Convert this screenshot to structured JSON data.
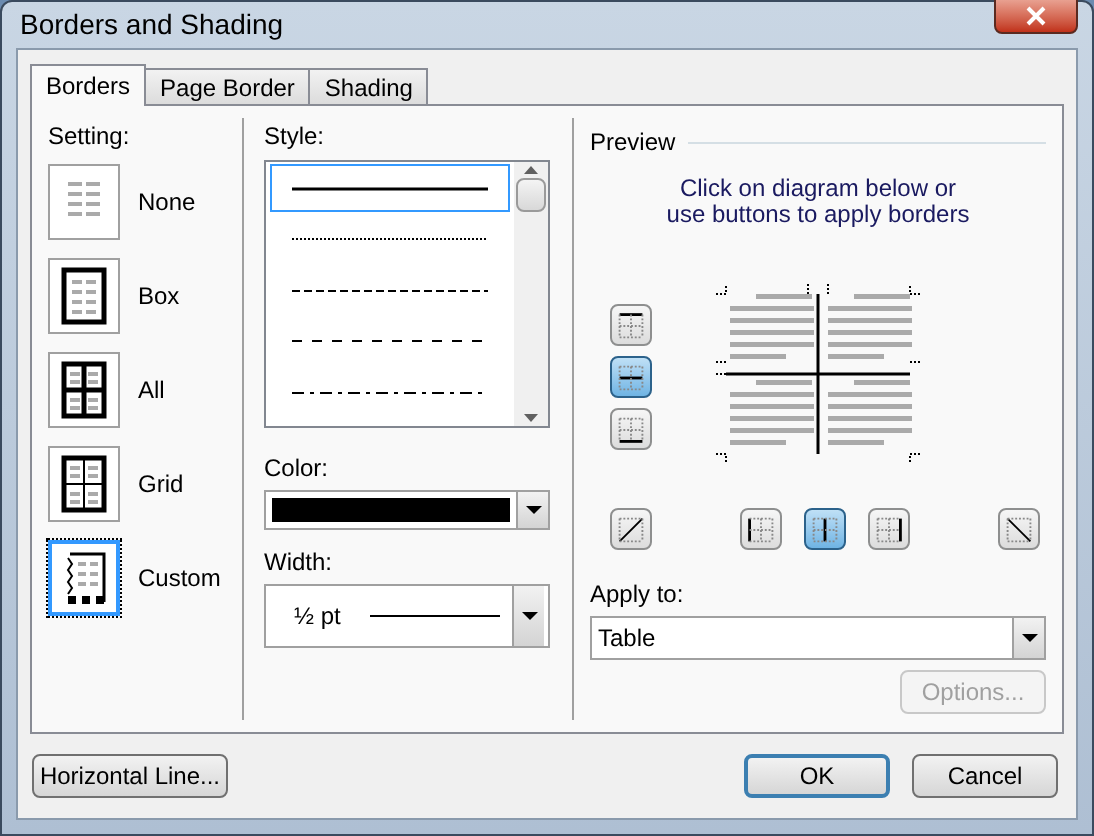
{
  "window": {
    "title": "Borders and Shading"
  },
  "tabs": [
    {
      "label": "Borders",
      "selected": true
    },
    {
      "label": "Page Border",
      "selected": false
    },
    {
      "label": "Shading",
      "selected": false
    }
  ],
  "setting": {
    "label": "Setting:",
    "items": [
      {
        "kind": "none",
        "label": "None",
        "selected": false
      },
      {
        "kind": "box",
        "label": "Box",
        "selected": false
      },
      {
        "kind": "all",
        "label": "All",
        "selected": false
      },
      {
        "kind": "grid",
        "label": "Grid",
        "selected": false
      },
      {
        "kind": "custom",
        "label": "Custom",
        "selected": true
      }
    ]
  },
  "style": {
    "label": "Style:",
    "items": [
      {
        "kind": "solid",
        "selected": true
      },
      {
        "kind": "dotted",
        "selected": false
      },
      {
        "kind": "dashed",
        "selected": false
      },
      {
        "kind": "dashed-wide",
        "selected": false
      },
      {
        "kind": "dash-dot",
        "selected": false
      }
    ]
  },
  "color": {
    "label": "Color:",
    "color": "#000000"
  },
  "width": {
    "label": "Width:",
    "value": "½ pt"
  },
  "preview": {
    "label": "Preview",
    "instruction": "Click on diagram below or use buttons to apply borders",
    "side_buttons": [
      {
        "kind": "top",
        "selected": false
      },
      {
        "kind": "inside-horizontal",
        "selected": true
      },
      {
        "kind": "bottom",
        "selected": false
      }
    ],
    "bottom_buttons": [
      {
        "kind": "diagonal-up",
        "selected": false
      },
      {
        "kind": "left",
        "selected": false
      },
      {
        "kind": "inside-vertical",
        "selected": true
      },
      {
        "kind": "right",
        "selected": false
      },
      {
        "kind": "diagonal-down",
        "selected": false
      }
    ]
  },
  "apply_to": {
    "label": "Apply to:",
    "value": "Table"
  },
  "options_button": {
    "label": "Options...",
    "disabled": true
  },
  "buttons": [
    {
      "label": "Horizontal Line..."
    },
    {
      "label": "OK",
      "default": true
    },
    {
      "label": "Cancel",
      "default": false
    }
  ]
}
